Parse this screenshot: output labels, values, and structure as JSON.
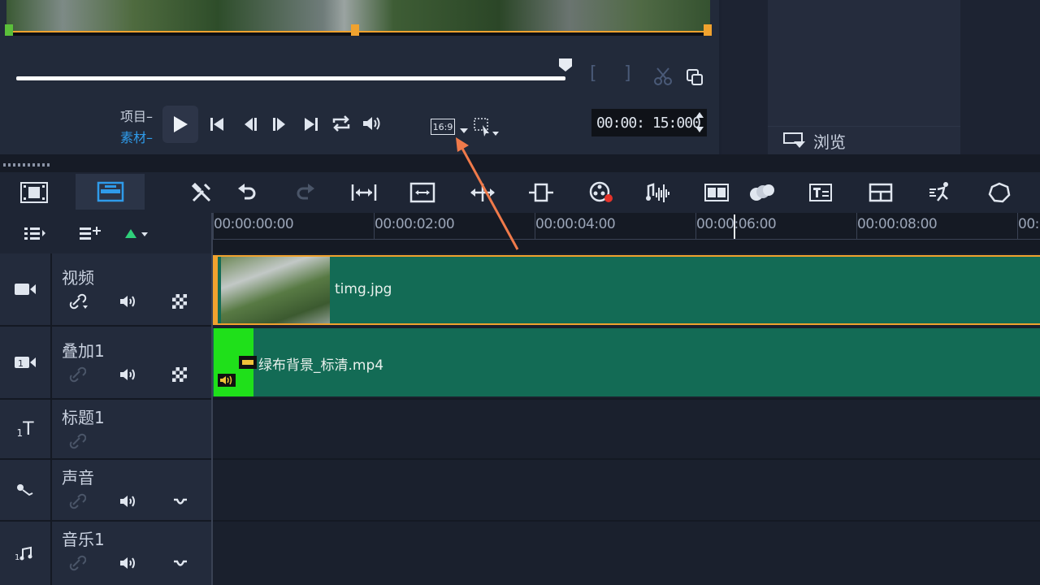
{
  "preview": {
    "mode_project": "项目–",
    "mode_clip": "素材–",
    "aspect_ratio": "16:9",
    "timecode": "00:00: 15:000"
  },
  "library": {
    "browse_label": "浏览"
  },
  "ruler": {
    "ticks": [
      "00:00:00:00",
      "00:00:02:00",
      "00:00:04:00",
      "00:00:06:00",
      "00:00:08:00",
      "00:"
    ]
  },
  "tracks": {
    "video": {
      "name": "视频"
    },
    "overlay": {
      "name": "叠加1"
    },
    "title": {
      "name": "标题1"
    },
    "voice": {
      "name": "声音"
    },
    "music": {
      "name": "音乐1"
    }
  },
  "clips": {
    "video_clip": "timg.jpg",
    "overlay_clip": "绿布背景_标清.mp4"
  },
  "colors": {
    "accent": "#f0a22e",
    "clip_green": "#136b55",
    "annotation_arrow": "#f07a4a"
  }
}
